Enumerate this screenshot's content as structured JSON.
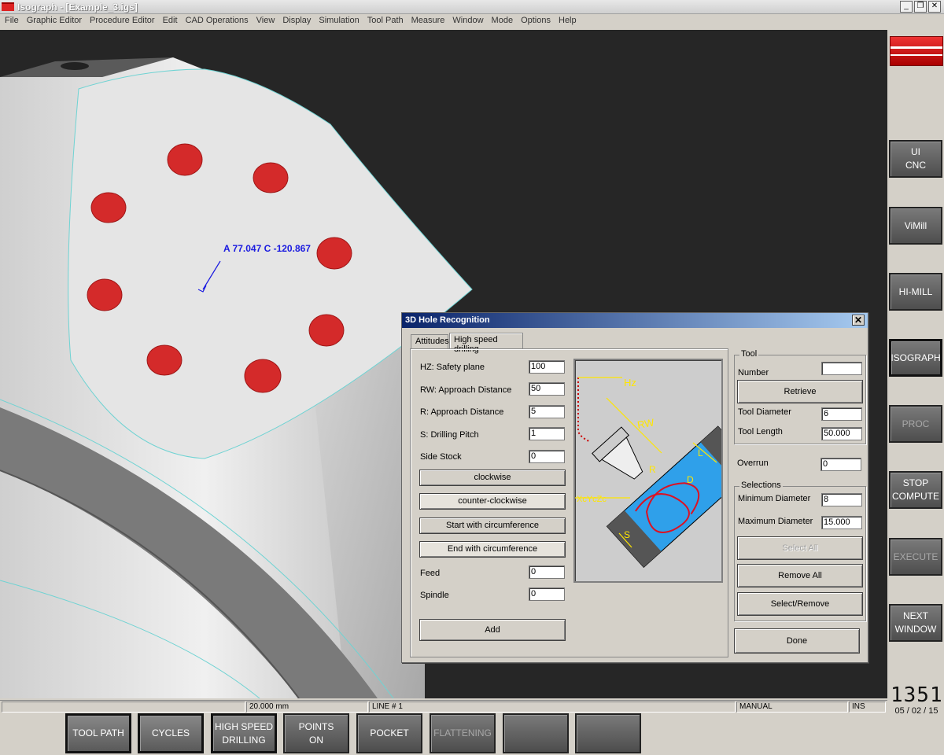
{
  "window": {
    "title": "Isograph - [Example_3.igs]",
    "min": "_",
    "max": "❐",
    "close": "✕"
  },
  "menu": [
    "File",
    "Graphic Editor",
    "Procedure Editor",
    "Edit",
    "CAD Operations",
    "View",
    "Display",
    "Simulation",
    "Tool Path",
    "Measure",
    "Window",
    "Mode",
    "Options",
    "Help"
  ],
  "viewport": {
    "annotation": "A 77.047 C -120.867",
    "hole_color": "#d42a2a"
  },
  "dialog": {
    "title": "3D Hole Recognition",
    "close": "✕",
    "tabs": [
      "Attitudes",
      "High speed drilling"
    ],
    "fields": {
      "hz_label": "HZ: Safety plane",
      "hz": "100",
      "rw_label": "RW: Approach Distance",
      "rw": "50",
      "r_label": "R: Approach Distance",
      "r": "5",
      "s_label": "S: Drilling Pitch",
      "s": "1",
      "side_label": "Side Stock",
      "side": "0",
      "feed_label": "Feed",
      "feed": "0",
      "spindle_label": "Spindle",
      "spindle": "0"
    },
    "buttons": {
      "clockwise": "clockwise",
      "counter": "counter-clockwise",
      "start_circ": "Start with circumference",
      "end_circ": "End with circumference",
      "add": "Add"
    },
    "diagram_labels": {
      "hz": "Hz",
      "rw": "RW",
      "r": "R",
      "d": "D",
      "l": "L",
      "s": "S",
      "xyz": "XcYcZc"
    },
    "tool": {
      "group": "Tool",
      "number_label": "Number",
      "number": "",
      "retrieve": "Retrieve",
      "diam_label": "Tool Diameter",
      "diam": "6",
      "len_label": "Tool Length",
      "len": "50.000"
    },
    "overrun_label": "Overrun",
    "overrun": "0",
    "selections": {
      "group": "Selections",
      "min_label": "Minimum Diameter",
      "min": "8",
      "max_label": "Maximum Diameter",
      "max": "15.000",
      "select_all": "Select All",
      "remove_all": "Remove All",
      "select_remove": "Select/Remove"
    },
    "done": "Done"
  },
  "right_panel": {
    "buttons": [
      {
        "l1": "UI",
        "l2": "CNC"
      },
      {
        "l1": "ViMill",
        "l2": ""
      },
      {
        "l1": "HI-MILL",
        "l2": ""
      },
      {
        "l1": "ISOGRAPH",
        "l2": ""
      },
      {
        "l1": "PROC",
        "l2": ""
      },
      {
        "l1": "STOP",
        "l2": "COMPUTE"
      },
      {
        "l1": "EXECUTE",
        "l2": ""
      },
      {
        "l1": "NEXT",
        "l2": "WINDOW"
      }
    ],
    "time": "1351",
    "date": "05 / 02 / 15"
  },
  "status": {
    "scale": "20.000 mm",
    "line": "LINE # 1",
    "mode": "MANUAL",
    "ins": "INS"
  },
  "bottom": [
    {
      "l1": "TOOL PATH",
      "l2": ""
    },
    {
      "l1": "CYCLES",
      "l2": ""
    },
    {
      "l1": "HIGH SPEED",
      "l2": "DRILLING"
    },
    {
      "l1": "POINTS",
      "l2": "ON"
    },
    {
      "l1": "POCKET",
      "l2": ""
    },
    {
      "l1": "FLATTENING",
      "l2": ""
    },
    {
      "l1": "",
      "l2": ""
    },
    {
      "l1": "",
      "l2": ""
    }
  ]
}
